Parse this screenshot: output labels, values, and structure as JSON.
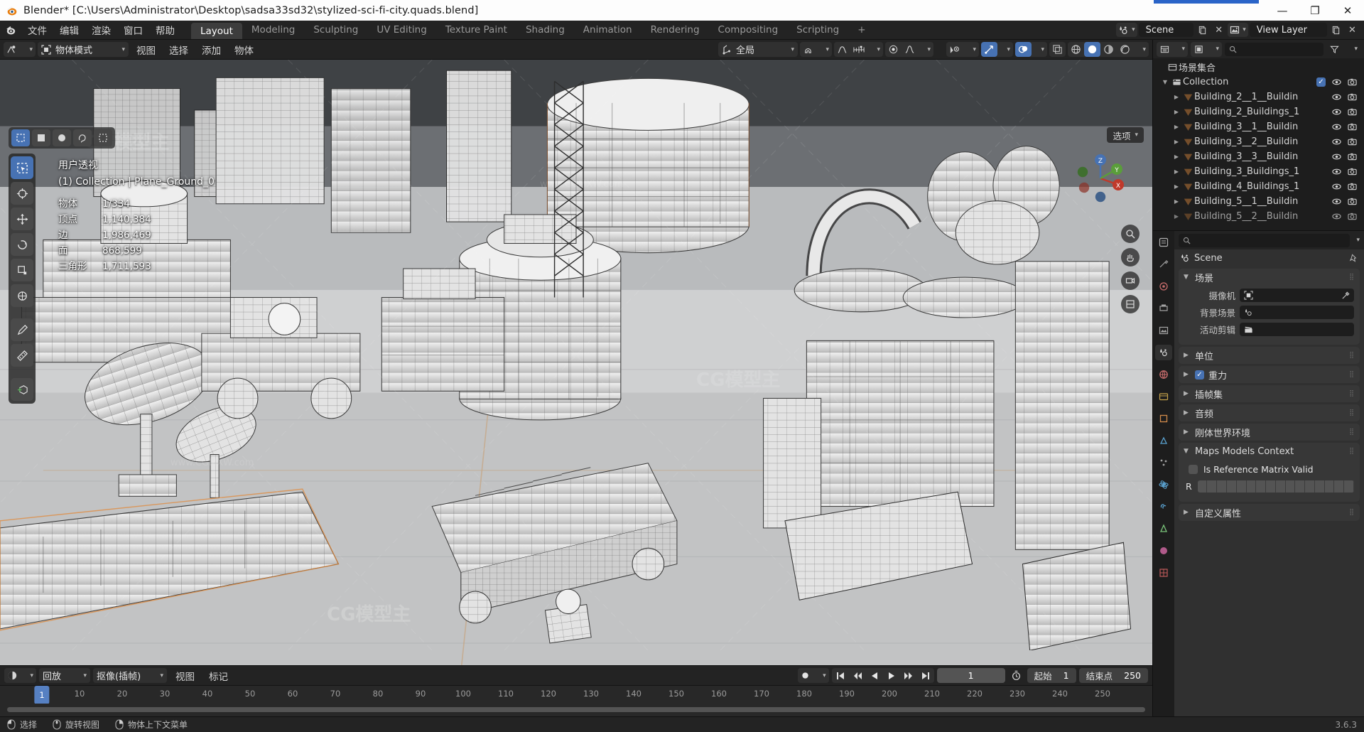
{
  "window": {
    "title": "Blender* [C:\\Users\\Administrator\\Desktop\\sadsa33sd32\\stylized-sci-fi-city.quads.blend]",
    "minimize": "—",
    "maximize": "❐",
    "close": "✕"
  },
  "topbar": {
    "menus": [
      "文件",
      "编辑",
      "渲染",
      "窗口",
      "帮助"
    ],
    "tabs": [
      {
        "label": "Layout",
        "active": true
      },
      {
        "label": "Modeling",
        "active": false
      },
      {
        "label": "Sculpting",
        "active": false
      },
      {
        "label": "UV Editing",
        "active": false
      },
      {
        "label": "Texture Paint",
        "active": false
      },
      {
        "label": "Shading",
        "active": false
      },
      {
        "label": "Animation",
        "active": false
      },
      {
        "label": "Rendering",
        "active": false
      },
      {
        "label": "Compositing",
        "active": false
      },
      {
        "label": "Scripting",
        "active": false
      },
      {
        "label": "+",
        "active": false
      }
    ],
    "scene_name": "Scene",
    "view_layer_name": "View Layer"
  },
  "viewport_header": {
    "mode": "物体模式",
    "menus": [
      "视图",
      "选择",
      "添加",
      "物体"
    ],
    "transform_orientation": "全局"
  },
  "viewport": {
    "view_name": "用户透视",
    "active_object": "(1) Collection | Plane_Ground_0",
    "options_label": "选项",
    "stats": [
      {
        "key": "物体",
        "value": "1/334"
      },
      {
        "key": "顶点",
        "value": "1,140,384"
      },
      {
        "key": "边",
        "value": "1,986,469"
      },
      {
        "key": "面",
        "value": "868,599"
      },
      {
        "key": "三角形",
        "value": "1,711,593"
      }
    ],
    "gizmo_axes": [
      "X",
      "Y",
      "Z"
    ],
    "watermarks": [
      "CG模型主",
      "www.CGMXW.com"
    ]
  },
  "timeline": {
    "menus": [
      "回放",
      "抠像(插帧)",
      "视图",
      "标记"
    ],
    "current_frame": "1",
    "start_label": "起始",
    "start_value": "1",
    "end_label": "结束点",
    "end_value": "250",
    "ticks": [
      "1",
      "10",
      "20",
      "30",
      "40",
      "50",
      "60",
      "70",
      "80",
      "90",
      "100",
      "110",
      "120",
      "130",
      "140",
      "150",
      "160",
      "170",
      "180",
      "190",
      "200",
      "210",
      "220",
      "230",
      "240",
      "250"
    ]
  },
  "outliner": {
    "search_placeholder": "",
    "display_mode": "视图层",
    "root": "场景集合",
    "items": [
      {
        "label": "Collection",
        "type": "collection",
        "depth": 0,
        "checkbox": true,
        "eye": true,
        "camera": true
      },
      {
        "label": "Building_2__1__Buildin",
        "type": "object",
        "depth": 1,
        "checkbox": false,
        "eye": true,
        "camera": true
      },
      {
        "label": "Building_2_Buildings_1",
        "type": "object",
        "depth": 1,
        "checkbox": false,
        "eye": true,
        "camera": true
      },
      {
        "label": "Building_3__1__Buildin",
        "type": "object",
        "depth": 1,
        "checkbox": false,
        "eye": true,
        "camera": true
      },
      {
        "label": "Building_3__2__Buildin",
        "type": "object",
        "depth": 1,
        "checkbox": false,
        "eye": true,
        "camera": true
      },
      {
        "label": "Building_3__3__Buildin",
        "type": "object",
        "depth": 1,
        "checkbox": false,
        "eye": true,
        "camera": true
      },
      {
        "label": "Building_3_Buildings_1",
        "type": "object",
        "depth": 1,
        "checkbox": false,
        "eye": true,
        "camera": true
      },
      {
        "label": "Building_4_Buildings_1",
        "type": "object",
        "depth": 1,
        "checkbox": false,
        "eye": true,
        "camera": true
      },
      {
        "label": "Building_5__1__Buildin",
        "type": "object",
        "depth": 1,
        "checkbox": false,
        "eye": true,
        "camera": true
      },
      {
        "label": "Building_5__2__Buildin",
        "type": "object",
        "depth": 1,
        "checkbox": false,
        "eye": true,
        "camera": true
      }
    ]
  },
  "properties": {
    "breadcrumb": "Scene",
    "search_placeholder": "",
    "panels": [
      {
        "title": "场景",
        "open": true
      },
      {
        "title": "单位",
        "open": false
      },
      {
        "title": "重力",
        "open": false,
        "checkbox": true
      },
      {
        "title": "插帧集",
        "open": false
      },
      {
        "title": "音频",
        "open": false
      },
      {
        "title": "刚体世界环境",
        "open": false
      },
      {
        "title": "Maps Models Context",
        "open": true
      },
      {
        "title": "自定义属性",
        "open": false
      }
    ],
    "scene_fields": [
      {
        "label": "摄像机",
        "value": ""
      },
      {
        "label": "背景场景",
        "value": ""
      },
      {
        "label": "活动剪辑",
        "value": ""
      }
    ],
    "maps_context": {
      "checkbox_label": "Is Reference Matrix Valid",
      "checkbox_checked": false,
      "array_label": "R"
    }
  },
  "statusbar": {
    "items": [
      {
        "label": "选择",
        "icon": "mouse-left"
      },
      {
        "label": "旋转视图",
        "icon": "mouse-middle"
      },
      {
        "label": "物体上下文菜单",
        "icon": "mouse-right"
      }
    ],
    "version": "3.6.3"
  },
  "colors": {
    "accent": "#4772b3",
    "header_bg": "#232323",
    "panel_bg": "#303030",
    "object_orange": "#e08a3c"
  }
}
